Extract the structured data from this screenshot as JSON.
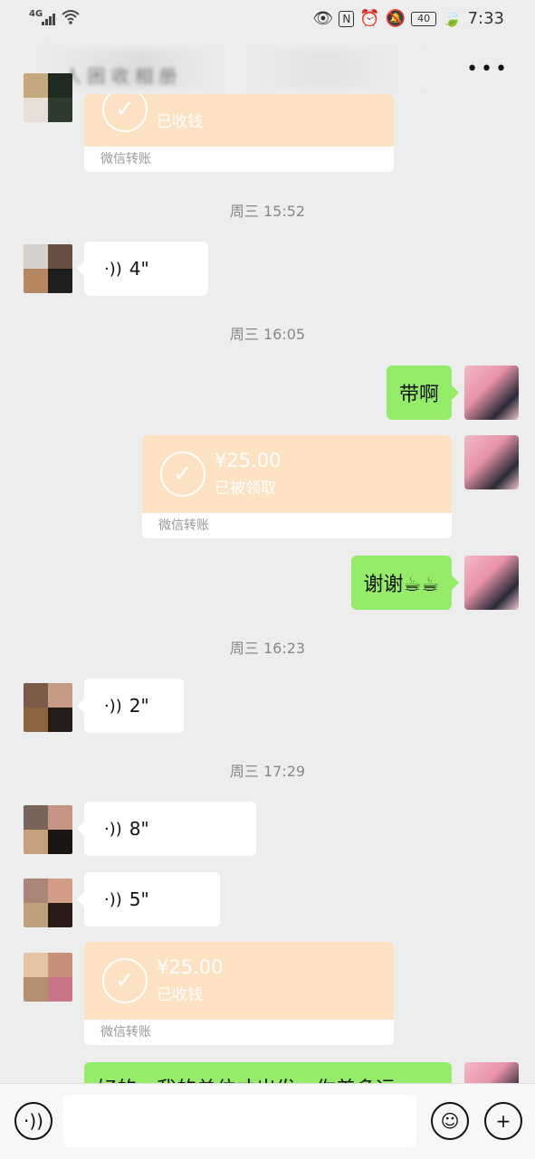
{
  "status_bar": {
    "network": "4G",
    "battery": "40",
    "time": "7:33"
  },
  "header": {
    "title": "人 困 收 相 册"
  },
  "colors": {
    "bg": "#ededed",
    "me_bubble": "#95ec69",
    "transfer": "#fce2c3"
  },
  "messages": {
    "top_transfer": {
      "state": "已收钱",
      "footer": "微信转账"
    },
    "time1": "周三 15:52",
    "voice1": "4\"",
    "time2": "周三 16:05",
    "me1": "带啊",
    "transfer2": {
      "amount": "¥25.00",
      "state": "已被领取",
      "footer": "微信转账"
    },
    "me2": "谢谢☕☕",
    "time3": "周三 16:23",
    "voice2": "2\"",
    "time4": "周三 17:29",
    "voice3": "8\"",
    "voice4": "5\"",
    "transfer3": {
      "amount": "¥25.00",
      "state": "已收钱",
      "footer": "微信转账"
    },
    "me3_partial": "好的，我的单位才出发，你差多远"
  }
}
